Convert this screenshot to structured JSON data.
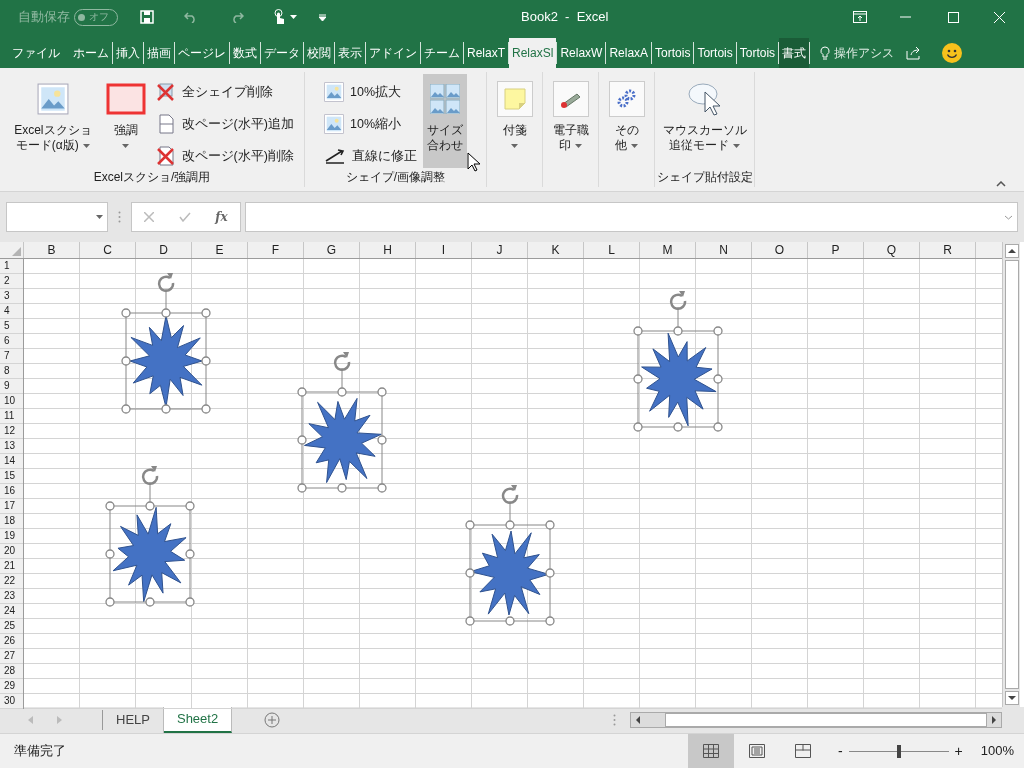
{
  "title_bar": {
    "autosave_label": "自動保存",
    "autosave_state": "オフ",
    "autosave_on": false,
    "title": "Book2  -  Excel"
  },
  "tabs": [
    {
      "label": "ファイル",
      "selected": false,
      "kind": "file"
    },
    {
      "label": "ホーム",
      "selected": false,
      "kind": "normal"
    },
    {
      "label": "挿入",
      "selected": false,
      "kind": "normal"
    },
    {
      "label": "描画",
      "selected": false,
      "kind": "normal"
    },
    {
      "label": "ページレ",
      "selected": false,
      "kind": "normal"
    },
    {
      "label": "数式",
      "selected": false,
      "kind": "normal"
    },
    {
      "label": "データ",
      "selected": false,
      "kind": "normal"
    },
    {
      "label": "校閲",
      "selected": false,
      "kind": "normal"
    },
    {
      "label": "表示",
      "selected": false,
      "kind": "normal"
    },
    {
      "label": "アドイン",
      "selected": false,
      "kind": "normal"
    },
    {
      "label": "チーム",
      "selected": false,
      "kind": "normal"
    },
    {
      "label": "RelaxT",
      "selected": false,
      "kind": "normal"
    },
    {
      "label": "RelaxSl",
      "selected": true,
      "kind": "normal"
    },
    {
      "label": "RelaxW",
      "selected": false,
      "kind": "normal"
    },
    {
      "label": "RelaxA",
      "selected": false,
      "kind": "normal"
    },
    {
      "label": "Tortois",
      "selected": false,
      "kind": "normal"
    },
    {
      "label": "Tortois",
      "selected": false,
      "kind": "normal"
    },
    {
      "label": "Tortois",
      "selected": false,
      "kind": "normal"
    },
    {
      "label": "書式",
      "selected": false,
      "kind": "contextual"
    }
  ],
  "tell_me": "操作アシス",
  "ribbon": {
    "groups": [
      {
        "label": "Excelスクショ/強調用",
        "items": [
          {
            "kind": "large",
            "lines": [
              "Excelスクショ",
              "モード(α版)"
            ],
            "dropdown": true,
            "highlighted": false
          },
          {
            "kind": "large",
            "lines": [
              "強調"
            ],
            "dropdown": true,
            "highlighted": false
          },
          {
            "kind": "stack",
            "children": [
              {
                "label": "全シェイプ削除"
              },
              {
                "label": "改ページ(水平)追加"
              },
              {
                "label": "改ページ(水平)削除"
              }
            ]
          }
        ]
      },
      {
        "label": "シェイプ/画像調整",
        "items": [
          {
            "kind": "stack",
            "children": [
              {
                "label": "10%拡大"
              },
              {
                "label": "10%縮小"
              },
              {
                "label": "直線に修正"
              }
            ]
          },
          {
            "kind": "large",
            "lines": [
              "サイズ",
              "合わせ"
            ],
            "dropdown": false,
            "highlighted": true
          }
        ]
      },
      {
        "items": [
          {
            "kind": "large",
            "lines": [
              "付箋"
            ],
            "dropdown": true,
            "highlighted": false
          }
        ]
      },
      {
        "items": [
          {
            "kind": "large",
            "lines": [
              "電子職",
              "印"
            ],
            "dropdown": true,
            "highlighted": false
          }
        ]
      },
      {
        "items": [
          {
            "kind": "large",
            "lines": [
              "その",
              "他"
            ],
            "dropdown": true,
            "highlighted": false
          }
        ]
      },
      {
        "label": "シェイプ貼付設定",
        "items": [
          {
            "kind": "large",
            "lines": [
              "マウスカーソル",
              "追従モード"
            ],
            "dropdown": true,
            "highlighted": false
          }
        ]
      }
    ]
  },
  "formula_bar": {
    "function_label": "fx"
  },
  "grid": {
    "columns": [
      "B",
      "C",
      "D",
      "E",
      "F",
      "G",
      "H",
      "I",
      "J",
      "K",
      "L",
      "M",
      "N",
      "O",
      "P",
      "Q",
      "R"
    ],
    "rows": [
      "1",
      "2",
      "3",
      "4",
      "5",
      "6",
      "7",
      "8",
      "9",
      "10",
      "11",
      "12",
      "13",
      "14",
      "15",
      "16",
      "17",
      "18",
      "19",
      "20",
      "21",
      "22",
      "23",
      "24",
      "25",
      "26",
      "27",
      "28",
      "29",
      "30"
    ]
  },
  "shapes": [
    {
      "selected": true
    },
    {
      "selected": true
    },
    {
      "selected": true
    },
    {
      "selected": true
    },
    {
      "selected": true
    }
  ],
  "sheet_tabs": [
    {
      "label": "HELP",
      "selected": false
    },
    {
      "label": "Sheet2",
      "selected": true
    }
  ],
  "status_bar": {
    "text": "準備完了",
    "views": [
      {
        "kind": "normal",
        "selected": true
      },
      {
        "kind": "page-layout",
        "selected": false
      },
      {
        "kind": "page-break",
        "selected": false
      }
    ],
    "zoom": {
      "minus": "-",
      "plus": "+",
      "level": 0.5,
      "reading": "100%"
    }
  }
}
